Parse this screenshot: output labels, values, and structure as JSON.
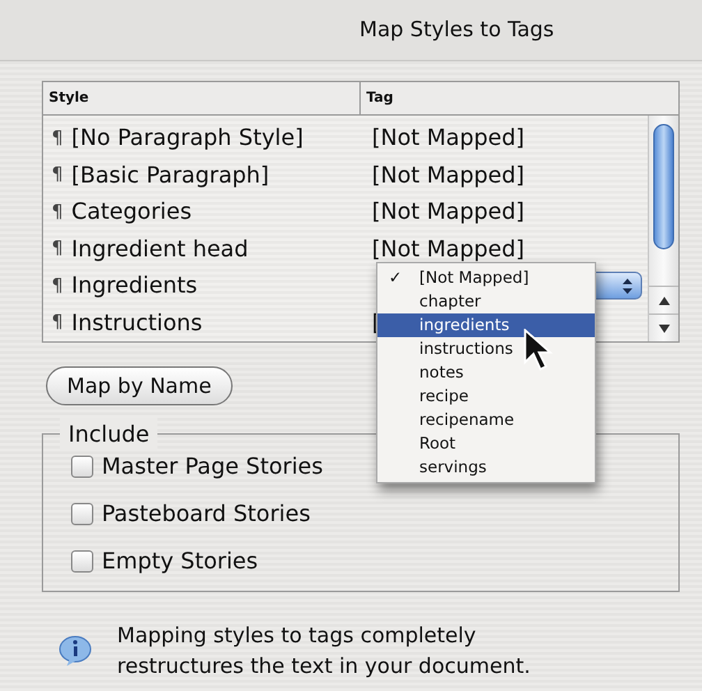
{
  "window": {
    "title": "Map Styles to Tags"
  },
  "table": {
    "columns": [
      "Style",
      "Tag"
    ],
    "rows": [
      {
        "style": "[No Paragraph Style]",
        "tag": "[Not Mapped]",
        "kind": "text"
      },
      {
        "style": "[Basic Paragraph]",
        "tag": "[Not Mapped]",
        "kind": "text"
      },
      {
        "style": "Categories",
        "tag": "[Not Mapped]",
        "kind": "text"
      },
      {
        "style": "Ingredient head",
        "tag": "[Not Mapped]",
        "kind": "text"
      },
      {
        "style": "Ingredients",
        "kind": "popup"
      },
      {
        "style": "Instructions",
        "tag": "[",
        "kind": "text"
      }
    ],
    "pilcrow": "¶"
  },
  "menu": {
    "items": [
      {
        "label": "[Not Mapped]",
        "checked": true,
        "selected": false
      },
      {
        "label": "chapter",
        "checked": false,
        "selected": false
      },
      {
        "label": "ingredients",
        "checked": false,
        "selected": true
      },
      {
        "label": "instructions",
        "checked": false,
        "selected": false
      },
      {
        "label": "notes",
        "checked": false,
        "selected": false
      },
      {
        "label": "recipe",
        "checked": false,
        "selected": false
      },
      {
        "label": "recipename",
        "checked": false,
        "selected": false
      },
      {
        "label": "Root",
        "checked": false,
        "selected": false
      },
      {
        "label": "servings",
        "checked": false,
        "selected": false
      }
    ],
    "check_mark": "✓"
  },
  "map_button": "Map by Name",
  "include": {
    "title": "Include",
    "options": [
      {
        "label": "Master Page Stories",
        "checked": false
      },
      {
        "label": "Pasteboard Stories",
        "checked": false
      },
      {
        "label": "Empty Stories",
        "checked": false
      }
    ]
  },
  "info": {
    "text": "Mapping styles to tags completely restructures the text in your document."
  }
}
